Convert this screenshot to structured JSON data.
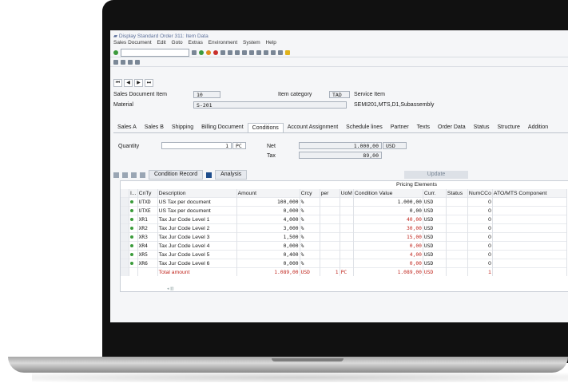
{
  "window": {
    "title": "Display Standard Order 311: Item Data"
  },
  "menu": [
    "Sales Document",
    "Edit",
    "Goto",
    "Extras",
    "Environment",
    "System",
    "Help"
  ],
  "header": {
    "item_label": "Sales Document Item",
    "item_value": "10",
    "category_label": "Item category",
    "category_value": "TAD",
    "category_desc": "Service Item",
    "material_label": "Material",
    "material_value": "S-201",
    "material_desc": "SEMI201,MTS,D1,Subassembly"
  },
  "tabs": [
    "Sales A",
    "Sales B",
    "Shipping",
    "Billing Document",
    "Conditions",
    "Account Assignment",
    "Schedule lines",
    "Partner",
    "Texts",
    "Order Data",
    "Status",
    "Structure",
    "Addition"
  ],
  "active_tab": "Conditions",
  "quantity": {
    "label": "Quantity",
    "value": "1",
    "unit": "PC",
    "net_label": "Net",
    "net_value": "1.000,00",
    "net_currency": "USD",
    "tax_label": "Tax",
    "tax_value": "89,00"
  },
  "cond_toolbar": {
    "condition_record": "Condition Record",
    "analysis": "Analysis",
    "update": "Update"
  },
  "grid": {
    "group_title": "Pricing Elements",
    "columns": [
      "I...",
      "CnTy",
      "Description",
      "Amount",
      "Crcy",
      "per",
      "UoM",
      "Condition Value",
      "Curr.",
      "Status",
      "NumCCo",
      "ATO/MTS Component"
    ],
    "rows": [
      {
        "cnty": "UTXD",
        "desc": "US Tax per document",
        "amount": "100,000",
        "crcy": "%",
        "per": "",
        "uom": "",
        "value": "1.000,00",
        "curr": "USD",
        "numcco": "0",
        "red": false
      },
      {
        "cnty": "UTXE",
        "desc": "US Tax per document",
        "amount": "0,000",
        "crcy": "%",
        "per": "",
        "uom": "",
        "value": "0,00",
        "curr": "USD",
        "numcco": "0",
        "red": false
      },
      {
        "cnty": "XR1",
        "desc": "Tax Jur Code Level 1",
        "amount": "4,000",
        "crcy": "%",
        "per": "",
        "uom": "",
        "value": "40,00",
        "curr": "USD",
        "numcco": "0",
        "red": true
      },
      {
        "cnty": "XR2",
        "desc": "Tax Jur Code Level 2",
        "amount": "3,000",
        "crcy": "%",
        "per": "",
        "uom": "",
        "value": "30,00",
        "curr": "USD",
        "numcco": "0",
        "red": true
      },
      {
        "cnty": "XR3",
        "desc": "Tax Jur Code Level 3",
        "amount": "1,500",
        "crcy": "%",
        "per": "",
        "uom": "",
        "value": "15,00",
        "curr": "USD",
        "numcco": "0",
        "red": true
      },
      {
        "cnty": "XR4",
        "desc": "Tax Jur Code Level 4",
        "amount": "0,000",
        "crcy": "%",
        "per": "",
        "uom": "",
        "value": "0,00",
        "curr": "USD",
        "numcco": "0",
        "red": true
      },
      {
        "cnty": "XR5",
        "desc": "Tax Jur Code Level 5",
        "amount": "0,400",
        "crcy": "%",
        "per": "",
        "uom": "",
        "value": "4,00",
        "curr": "USD",
        "numcco": "0",
        "red": true
      },
      {
        "cnty": "XR6",
        "desc": "Tax Jur Code Level 6",
        "amount": "0,000",
        "crcy": "%",
        "per": "",
        "uom": "",
        "value": "0,00",
        "curr": "USD",
        "numcco": "0",
        "red": true
      }
    ],
    "total": {
      "desc": "Total amount",
      "amount": "1.089,00",
      "crcy": "USD",
      "per": "1",
      "uom": "PC",
      "value": "1.089,00",
      "curr": "USD",
      "numcco": "1"
    }
  },
  "colors": {
    "accent": "#1e4d8c",
    "negative": "#c0271f",
    "status_green": "#3a9b3a"
  }
}
